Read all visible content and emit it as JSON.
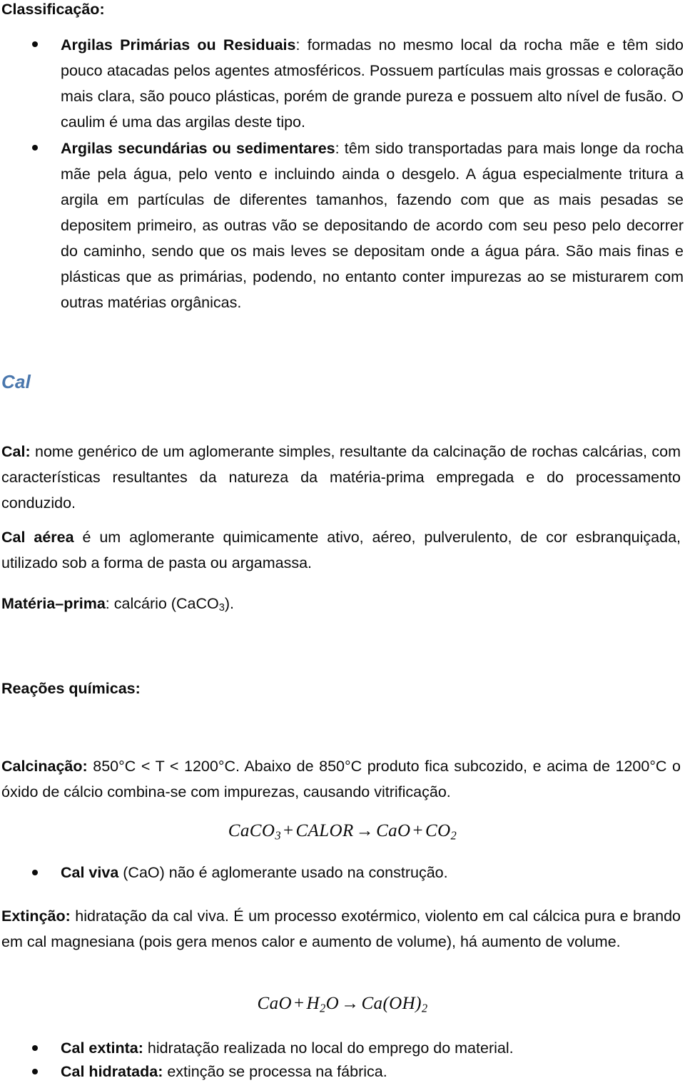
{
  "document": {
    "language": "pt-BR",
    "accent_color": "#4a77ad",
    "text_color": "#0b0b0b",
    "background_color": "#ffffff"
  },
  "section_classificacao": {
    "heading": "Classificação:",
    "bullets": [
      {
        "lead": "Argilas Primárias ou Residuais",
        "separator": ": ",
        "body": "formadas no mesmo local da rocha mãe e têm sido pouco atacadas pelos agentes atmosféricos. Possuem partículas mais grossas e coloração mais clara, são pouco plásticas, porém de grande pureza e possuem alto nível de fusão. O caulim é uma das argilas deste tipo."
      },
      {
        "lead": "Argilas secundárias ou sedimentares",
        "separator": ": ",
        "body": "têm sido transportadas para mais longe da rocha mãe pela água, pelo vento e incluindo ainda o desgelo. A água especialmente tritura a argila em partículas de diferentes tamanhos, fazendo com que as mais pesadas se depositem primeiro, as outras vão se depositando de acordo com seu peso pelo decorrer do caminho, sendo que os mais leves se depositam onde a água pára. São mais finas e plásticas que as primárias, podendo, no entanto conter impurezas ao se misturarem com outras matérias orgânicas."
      }
    ]
  },
  "section_cal": {
    "heading": "Cal",
    "definition": {
      "lead": "Cal:",
      "body": " nome genérico de um aglomerante simples, resultante da calcinação de rochas calcárias, com características resultantes da natureza da matéria-prima empregada e do processamento conduzido."
    },
    "cal_aerea": {
      "lead": "Cal aérea",
      "body": " é um aglomerante quimicamente ativo, aéreo, pulverulento, de cor esbranquiçada, utilizado sob a forma de pasta ou argamassa."
    },
    "materia_prima": {
      "lead": "Matéria–prima",
      "separator": ": ",
      "body_pre": "calcário (CaCO",
      "subscript": "3",
      "body_post": ")."
    }
  },
  "section_reacoes": {
    "heading": "Reações químicas:",
    "calcinacao": {
      "lead": "Calcinação:",
      "body": " 850°C < T < 1200°C. Abaixo de 850°C produto fica subcozido, e acima de 1200°C o óxido de cálcio combina-se com impurezas, causando vitrificação."
    },
    "formula_calcinacao": {
      "reactant_1": "CaCO",
      "reactant_1_sub": "3",
      "plus_1": "+",
      "reactant_2": "CALOR",
      "arrow": "→",
      "product_1": "CaO",
      "plus_2": "+",
      "product_2": "CO",
      "product_2_sub": "2",
      "plain": "CaCO3 + CALOR → CaO + CO2"
    },
    "bullet_cal_viva": {
      "lead": "Cal viva",
      "body": " (CaO) não é aglomerante usado na construção."
    },
    "extincao": {
      "lead": "Extinção:",
      "body": " hidratação da cal viva. É um processo exotérmico, violento em cal cálcica pura e brando em cal magnesiana (pois gera menos calor e aumento de volume), há aumento de volume."
    },
    "formula_extincao": {
      "reactant_1": "CaO",
      "plus_1": "+",
      "reactant_2_a": "H",
      "reactant_2_sub": "2",
      "reactant_2_b": "O",
      "arrow": "→",
      "product_1_a": "Ca(OH)",
      "product_1_sub": "2",
      "plain": "CaO + H2O → Ca(OH)2"
    },
    "bullets_final": [
      {
        "lead": "Cal extinta:",
        "body": " hidratação realizada no local do emprego do material."
      },
      {
        "lead": "Cal hidratada:",
        "body": " extinção se processa na fábrica."
      }
    ]
  }
}
